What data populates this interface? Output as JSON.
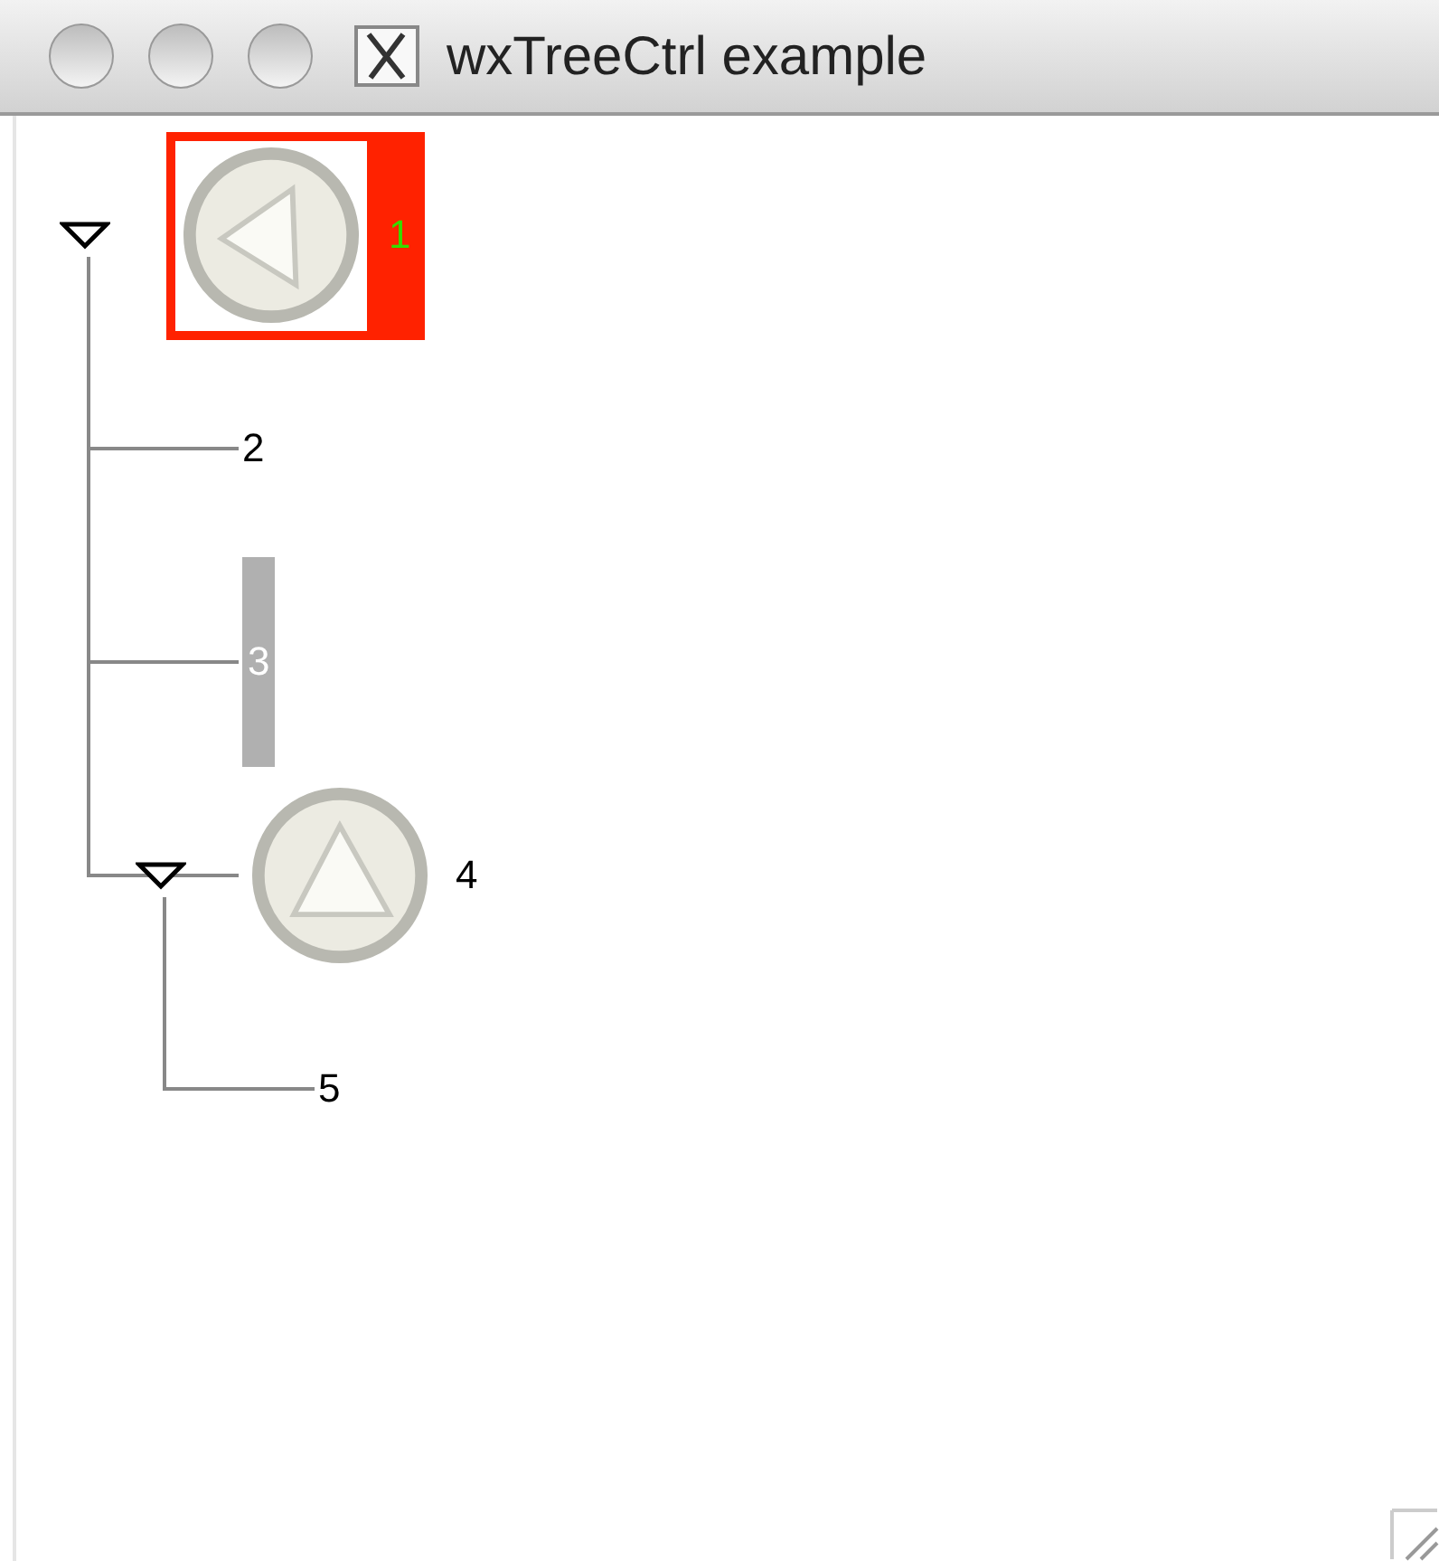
{
  "window": {
    "title": "wxTreeCtrl example"
  },
  "tree": [
    {
      "label": "1",
      "kind": "leftarrow",
      "expanded": true,
      "selected": true,
      "children": [
        {
          "label": "2",
          "kind": "text",
          "selected": false
        },
        {
          "label": "3",
          "kind": "shaded",
          "selected": false
        },
        {
          "label": "4",
          "kind": "uparrow",
          "expanded": true,
          "selected": false,
          "children": [
            {
              "label": "5",
              "kind": "text",
              "selected": false
            }
          ]
        }
      ]
    }
  ]
}
